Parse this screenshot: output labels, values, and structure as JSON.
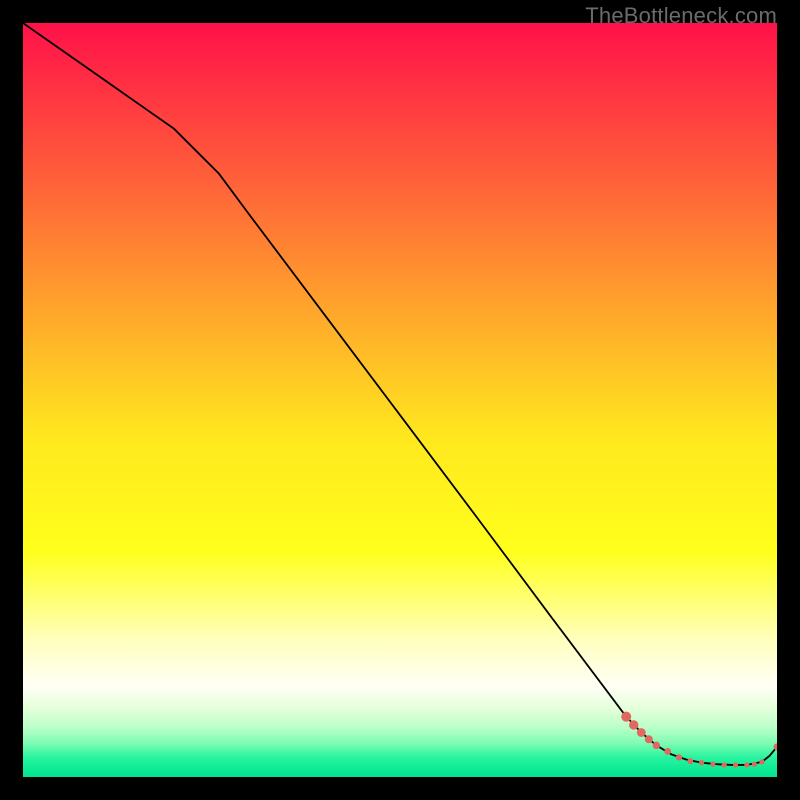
{
  "watermark": "TheBottleneck.com",
  "chart_data": {
    "type": "line",
    "title": "",
    "xlabel": "",
    "ylabel": "",
    "xlim": [
      0,
      100
    ],
    "ylim": [
      0,
      100
    ],
    "grid": false,
    "legend": false,
    "gradient": {
      "stops": [
        {
          "offset": 0.0,
          "color": "#ff1149"
        },
        {
          "offset": 0.2,
          "color": "#ff5d3a"
        },
        {
          "offset": 0.4,
          "color": "#ffad2a"
        },
        {
          "offset": 0.55,
          "color": "#ffe81e"
        },
        {
          "offset": 0.7,
          "color": "#ffff1c"
        },
        {
          "offset": 0.82,
          "color": "#ffffc0"
        },
        {
          "offset": 0.88,
          "color": "#fffff6"
        },
        {
          "offset": 0.91,
          "color": "#e3ffd9"
        },
        {
          "offset": 0.935,
          "color": "#b8ffc8"
        },
        {
          "offset": 0.955,
          "color": "#7efcb3"
        },
        {
          "offset": 0.975,
          "color": "#24f39e"
        },
        {
          "offset": 1.0,
          "color": "#00e58d"
        }
      ]
    },
    "series": [
      {
        "name": "curve",
        "stroke": "#000000",
        "stroke_width": 1.8,
        "x": [
          0,
          10,
          20,
          26,
          30,
          40,
          50,
          60,
          70,
          80,
          82,
          84,
          86,
          88,
          90,
          92,
          94,
          96,
          98,
          99,
          100
        ],
        "y": [
          100,
          93.0,
          86.0,
          80.0,
          74.6,
          61.3,
          48.0,
          34.7,
          21.3,
          8.0,
          5.9,
          4.2,
          3.0,
          2.3,
          1.9,
          1.7,
          1.6,
          1.6,
          2.0,
          2.8,
          4.0
        ]
      }
    ],
    "markers": {
      "color": "#e0685f",
      "points": [
        {
          "x": 80.0,
          "y": 8.0,
          "r": 5.0
        },
        {
          "x": 81.0,
          "y": 6.9,
          "r": 4.7
        },
        {
          "x": 82.0,
          "y": 5.9,
          "r": 4.4
        },
        {
          "x": 83.0,
          "y": 5.0,
          "r": 4.0
        },
        {
          "x": 84.0,
          "y": 4.2,
          "r": 3.7
        },
        {
          "x": 85.5,
          "y": 3.4,
          "r": 3.4
        },
        {
          "x": 87.0,
          "y": 2.6,
          "r": 3.1
        },
        {
          "x": 88.5,
          "y": 2.1,
          "r": 2.9
        },
        {
          "x": 90.0,
          "y": 1.9,
          "r": 2.7
        },
        {
          "x": 91.5,
          "y": 1.7,
          "r": 2.6
        },
        {
          "x": 93.0,
          "y": 1.6,
          "r": 2.6
        },
        {
          "x": 94.5,
          "y": 1.6,
          "r": 2.6
        },
        {
          "x": 96.0,
          "y": 1.6,
          "r": 2.6
        },
        {
          "x": 97.0,
          "y": 1.7,
          "r": 2.6
        },
        {
          "x": 98.0,
          "y": 2.0,
          "r": 2.6
        },
        {
          "x": 100.0,
          "y": 4.0,
          "r": 3.5
        }
      ]
    }
  }
}
